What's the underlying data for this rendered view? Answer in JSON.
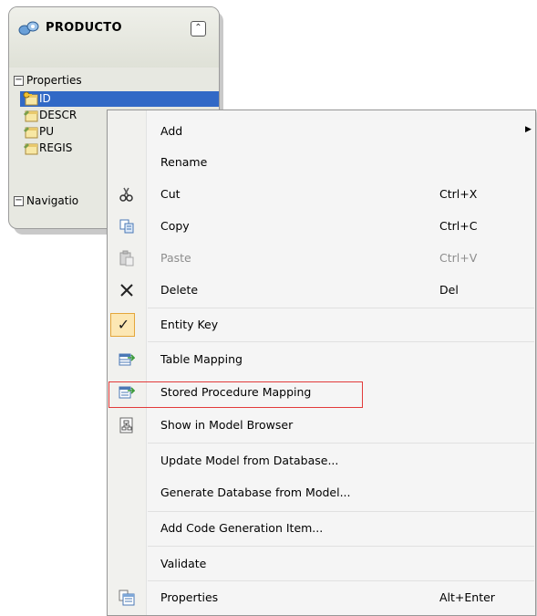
{
  "entity": {
    "title": "PRODUCTO",
    "collapse_glyph": "⌃",
    "properties_section": {
      "label": "Properties",
      "toggle": "−"
    },
    "properties": [
      {
        "label": "ID",
        "selected": true,
        "icon": "key-property-icon"
      },
      {
        "label": "DESCR",
        "selected": false,
        "icon": "property-icon"
      },
      {
        "label": "PU",
        "selected": false,
        "icon": "property-icon"
      },
      {
        "label": "REGIS",
        "selected": false,
        "icon": "property-icon"
      }
    ],
    "navigation_section": {
      "label": "Navigatio",
      "toggle": "−"
    }
  },
  "menu": {
    "items": [
      {
        "label": "Add",
        "shortcut": "",
        "submenu": true
      },
      {
        "label": "Rename",
        "shortcut": ""
      },
      {
        "label": "Cut",
        "shortcut": "Ctrl+X",
        "icon": "scissors-icon"
      },
      {
        "label": "Copy",
        "shortcut": "Ctrl+C",
        "icon": "copy-icon"
      },
      {
        "label": "Paste",
        "shortcut": "Ctrl+V",
        "icon": "paste-icon",
        "disabled": true
      },
      {
        "label": "Delete",
        "shortcut": "Del",
        "icon": "delete-icon"
      },
      {
        "label": "Entity Key",
        "shortcut": "",
        "icon": "check-icon",
        "checked": true
      },
      {
        "label": "Table Mapping",
        "shortcut": "",
        "icon": "table-mapping-icon"
      },
      {
        "label": "Stored Procedure Mapping",
        "shortcut": "",
        "icon": "stored-procedure-icon",
        "highlighted": true
      },
      {
        "label": "Show in Model Browser",
        "shortcut": "",
        "icon": "model-browser-icon"
      },
      {
        "label": "Update Model from Database...",
        "shortcut": ""
      },
      {
        "label": "Generate Database from Model...",
        "shortcut": ""
      },
      {
        "label": "Add Code Generation Item...",
        "shortcut": ""
      },
      {
        "label": "Validate",
        "shortcut": ""
      },
      {
        "label": "Properties",
        "shortcut": "Alt+Enter",
        "icon": "properties-icon"
      }
    ],
    "highlight_color": "#e23a3a",
    "selection_color": "#3169c6"
  }
}
